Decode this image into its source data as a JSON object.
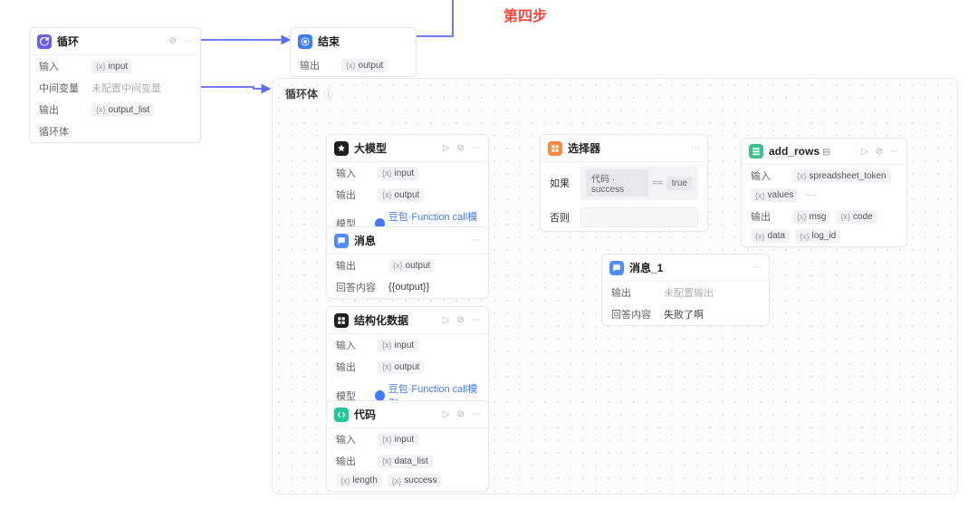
{
  "step_label": "第四步",
  "loop_node": {
    "title": "循环",
    "input_label": "输入",
    "input_var": "input",
    "midvar_label": "中间变量",
    "midvar_placeholder": "未配置中间变量",
    "output_label": "输出",
    "output_var": "output_list",
    "body_label": "循环体"
  },
  "end_node": {
    "title": "结束",
    "output_label": "输出",
    "output_var": "output"
  },
  "loopbody": {
    "title": "循环体"
  },
  "llm_a": {
    "title": "大模型",
    "input_label": "输入",
    "input_var": "input",
    "output_label": "输出",
    "output_var": "output",
    "model_label": "模型",
    "model_name": "豆包·Function call模型"
  },
  "msg_a": {
    "title": "消息",
    "output_label": "输出",
    "output_var": "output",
    "answer_label": "回答内容",
    "answer_value": "{{output}}"
  },
  "struct": {
    "title": "结构化数据",
    "input_label": "输入",
    "input_var": "input",
    "output_label": "输出",
    "output_var": "output",
    "model_label": "模型",
    "model_name": "豆包·Function call模型"
  },
  "code": {
    "title": "代码",
    "input_label": "输入",
    "input_var": "input",
    "output_label": "输出",
    "output_var1": "data_list",
    "output_var2": "length",
    "output_var3": "success"
  },
  "selector": {
    "title": "选择器",
    "if_label": "如果",
    "else_label": "否则",
    "cond_var_prefix": "代码",
    "cond_var": "success",
    "cond_op": "==",
    "cond_val": "true"
  },
  "msg_b": {
    "title": "消息_1",
    "output_label": "输出",
    "output_placeholder": "未配置输出",
    "answer_label": "回答内容",
    "answer_value": "失败了啊"
  },
  "addrows": {
    "title": "add_rows",
    "input_label": "输入",
    "input_var1": "spreadsheet_token",
    "input_var2": "values",
    "output_label": "输出",
    "output_var1": "msg",
    "output_var2": "code",
    "output_var3": "data",
    "output_var4": "log_id"
  }
}
